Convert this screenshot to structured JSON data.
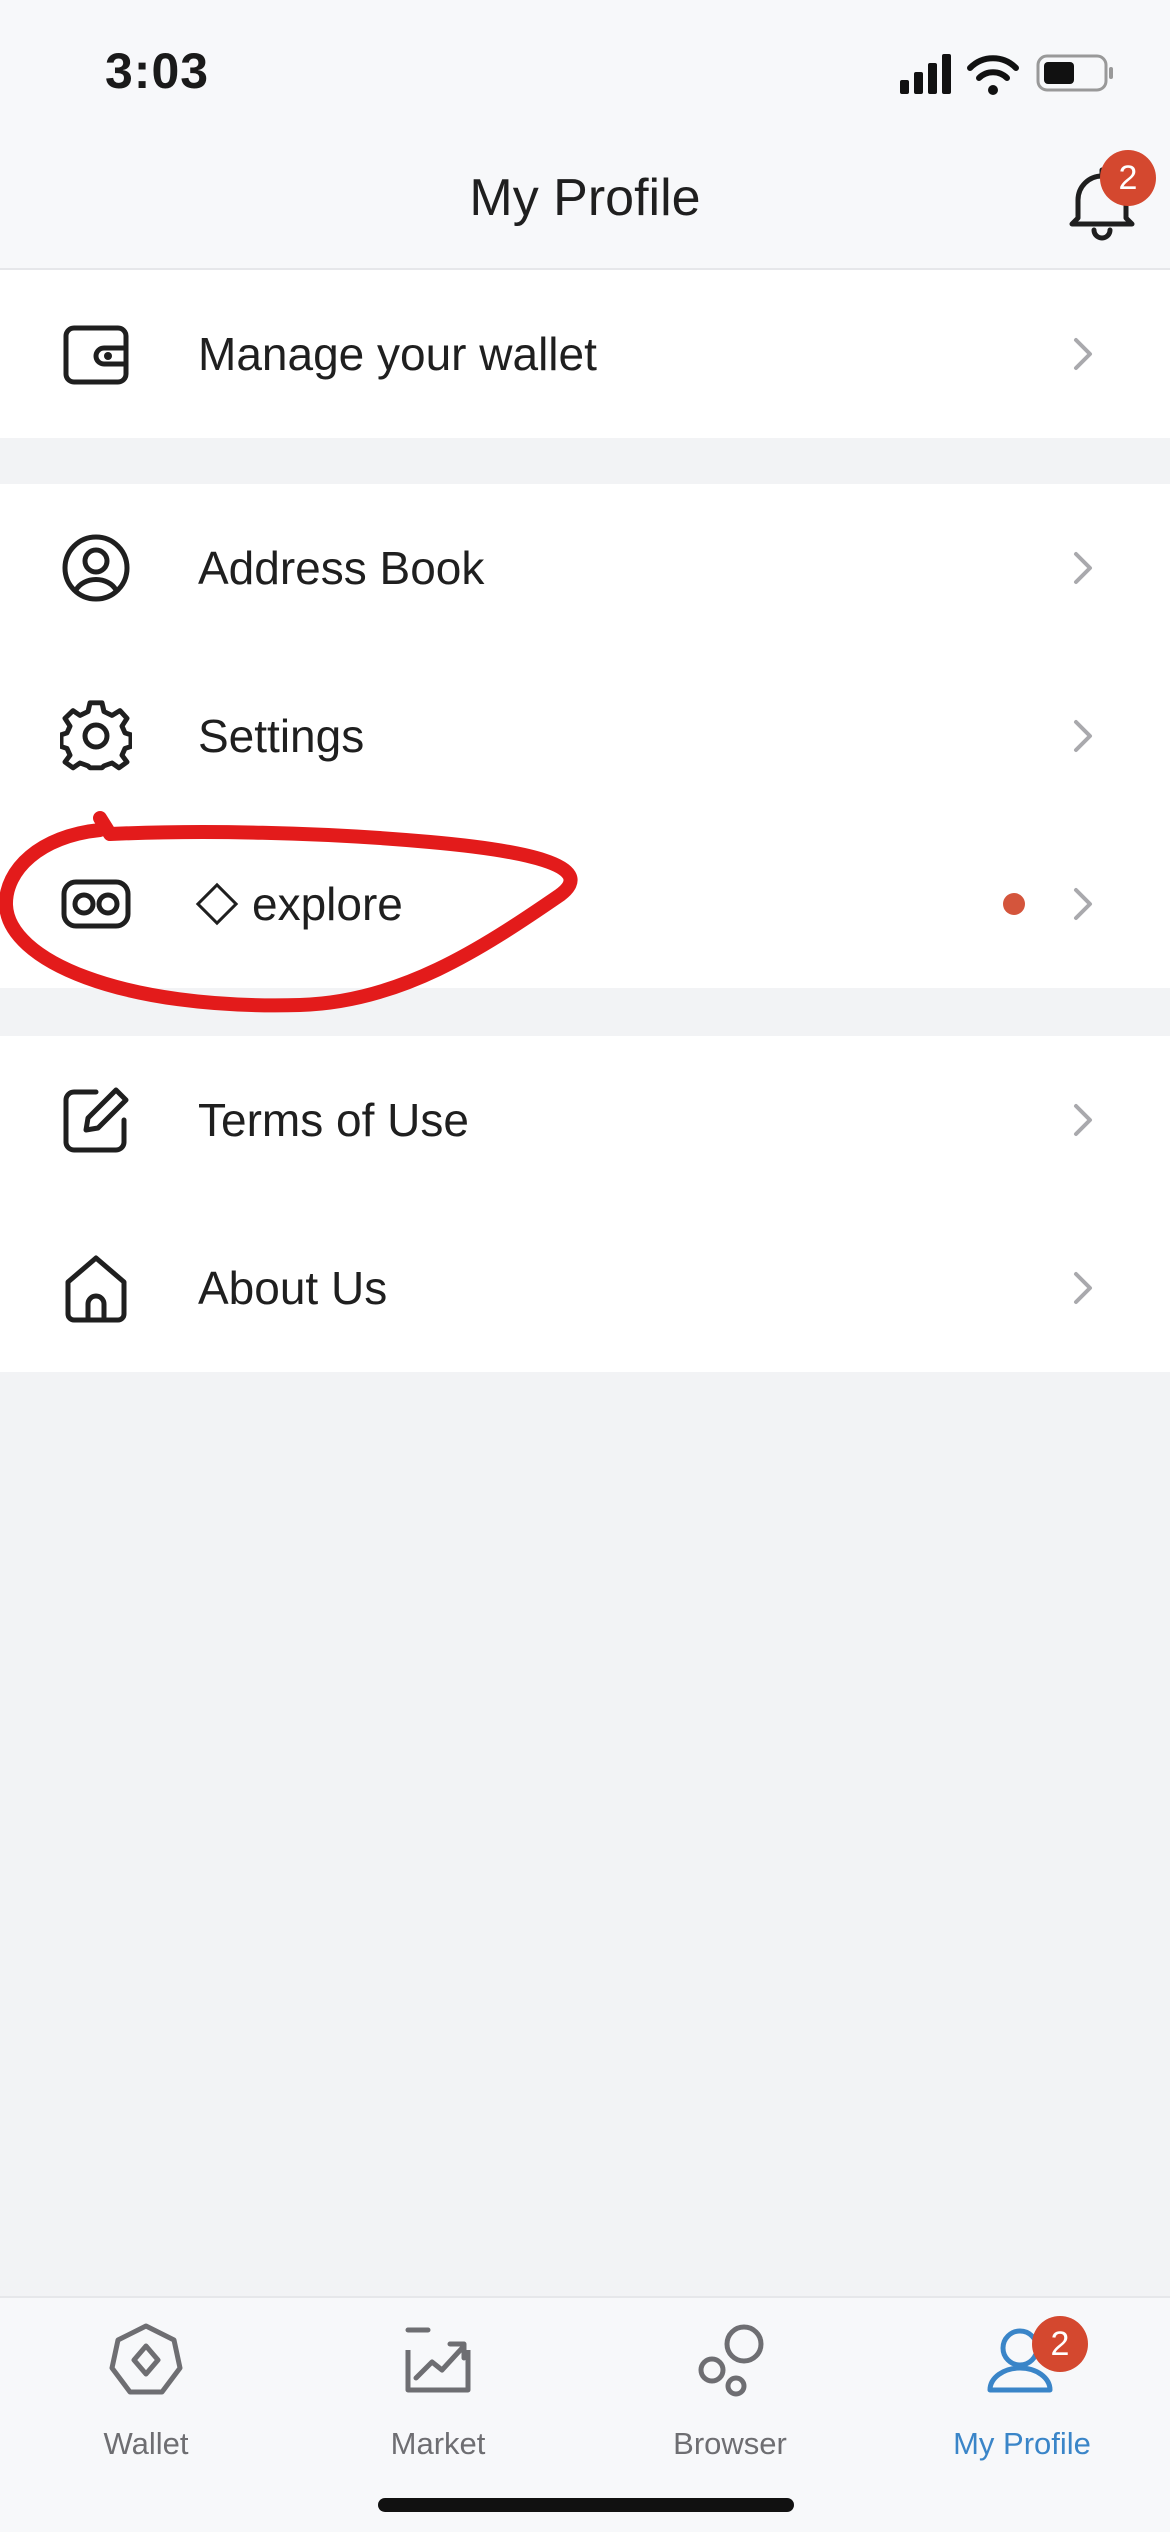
{
  "status_bar": {
    "time": "3:03"
  },
  "header": {
    "title": "My Profile",
    "notification_count": "2"
  },
  "groups": [
    {
      "items": [
        {
          "label": "Manage your wallet",
          "icon": "wallet-icon"
        }
      ]
    },
    {
      "items": [
        {
          "label": "Address Book",
          "icon": "user-circle-icon"
        },
        {
          "label": "Settings",
          "icon": "gear-icon"
        },
        {
          "label": "explore",
          "icon": "vr-goggles-icon",
          "has_new_dot": true
        }
      ]
    },
    {
      "items": [
        {
          "label": "Terms of Use",
          "icon": "edit-icon"
        },
        {
          "label": "About Us",
          "icon": "home-icon"
        }
      ]
    }
  ],
  "tabbar": {
    "tabs": [
      {
        "label": "Wallet",
        "icon": "wallet-hexagon-icon"
      },
      {
        "label": "Market",
        "icon": "market-chart-icon"
      },
      {
        "label": "Browser",
        "icon": "bubbles-icon"
      },
      {
        "label": "My Profile",
        "icon": "profile-icon",
        "active": true,
        "badge": "2"
      }
    ]
  },
  "colors": {
    "accent": "#3a85c8",
    "badge": "#d4482f",
    "annotation": "#e31b1b"
  }
}
